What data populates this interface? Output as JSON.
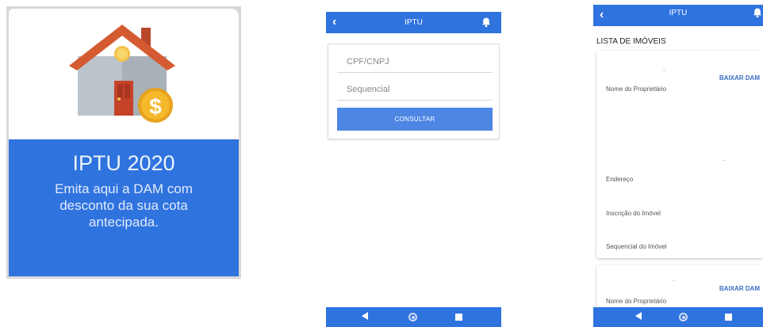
{
  "promo": {
    "title": "IPTU 2020",
    "text": "Emita aqui a DAM com desconto da sua cota antecipada.",
    "coin_symbol": "$"
  },
  "consult_screen": {
    "appbar_title": "IPTU",
    "cpf_placeholder": "CPF/CNPJ",
    "sequencial_placeholder": "Sequencial",
    "consult_button": "CONSULTAR"
  },
  "list_screen": {
    "appbar_title": "IPTU",
    "list_title": "LISTA DE IMÓVEIS",
    "card1": {
      "owner_label": "Nome do Proprietário",
      "download_button": "BAIXAR DAM",
      "address_label": "Endereço",
      "registration_label": "Inscrição do Imóvel",
      "sequence_label": "Sequencial do Imóvel"
    },
    "card2": {
      "owner_label": "Nome do Proprietário",
      "download_button": "BAIXAR DAM"
    }
  },
  "colors": {
    "primary": "#2f73df",
    "button": "#4e86e4",
    "download_link": "#3a6fc4",
    "roof": "#d45b31",
    "coin": "#f5b82a"
  },
  "icons": {
    "back": "chevron-left-icon",
    "notifications": "bell-icon",
    "nav_back": "triangle-back-icon",
    "nav_home": "circle-home-icon",
    "nav_recent": "square-recent-icon"
  }
}
